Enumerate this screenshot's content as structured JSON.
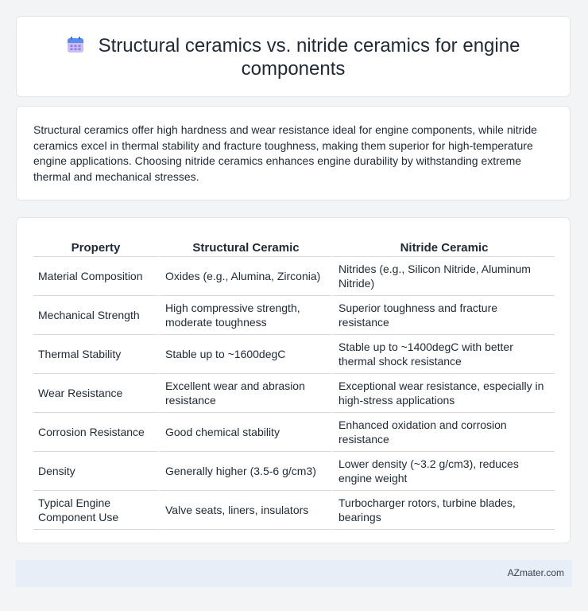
{
  "header": {
    "icon": "calendar-icon",
    "title": "Structural ceramics vs. nitride ceramics for engine components"
  },
  "summary": "Structural ceramics offer high hardness and wear resistance ideal for engine components, while nitride ceramics excel in thermal stability and fracture toughness, making them superior for high-temperature engine applications. Choosing nitride ceramics enhances engine durability by withstanding extreme thermal and mechanical stresses.",
  "table": {
    "headers": [
      "Property",
      "Structural Ceramic",
      "Nitride Ceramic"
    ],
    "rows": [
      [
        "Material Composition",
        "Oxides (e.g., Alumina, Zirconia)",
        "Nitrides (e.g., Silicon Nitride, Aluminum Nitride)"
      ],
      [
        "Mechanical Strength",
        "High compressive strength, moderate toughness",
        "Superior toughness and fracture resistance"
      ],
      [
        "Thermal Stability",
        "Stable up to ~1600degC",
        "Stable up to ~1400degC with better thermal shock resistance"
      ],
      [
        "Wear Resistance",
        "Excellent wear and abrasion resistance",
        "Exceptional wear resistance, especially in high-stress applications"
      ],
      [
        "Corrosion Resistance",
        "Good chemical stability",
        "Enhanced oxidation and corrosion resistance"
      ],
      [
        "Density",
        "Generally higher (3.5-6 g/cm3)",
        "Lower density (~3.2 g/cm3), reduces engine weight"
      ],
      [
        "Typical Engine Component Use",
        "Valve seats, liners, insulators",
        "Turbocharger rotors, turbine blades, bearings"
      ]
    ]
  },
  "footer": {
    "brand": "AZmater.com"
  },
  "colors": {
    "icon_top": "#5b8def",
    "icon_body": "#c7b8f5",
    "footer_bg": "#e8eef8"
  }
}
